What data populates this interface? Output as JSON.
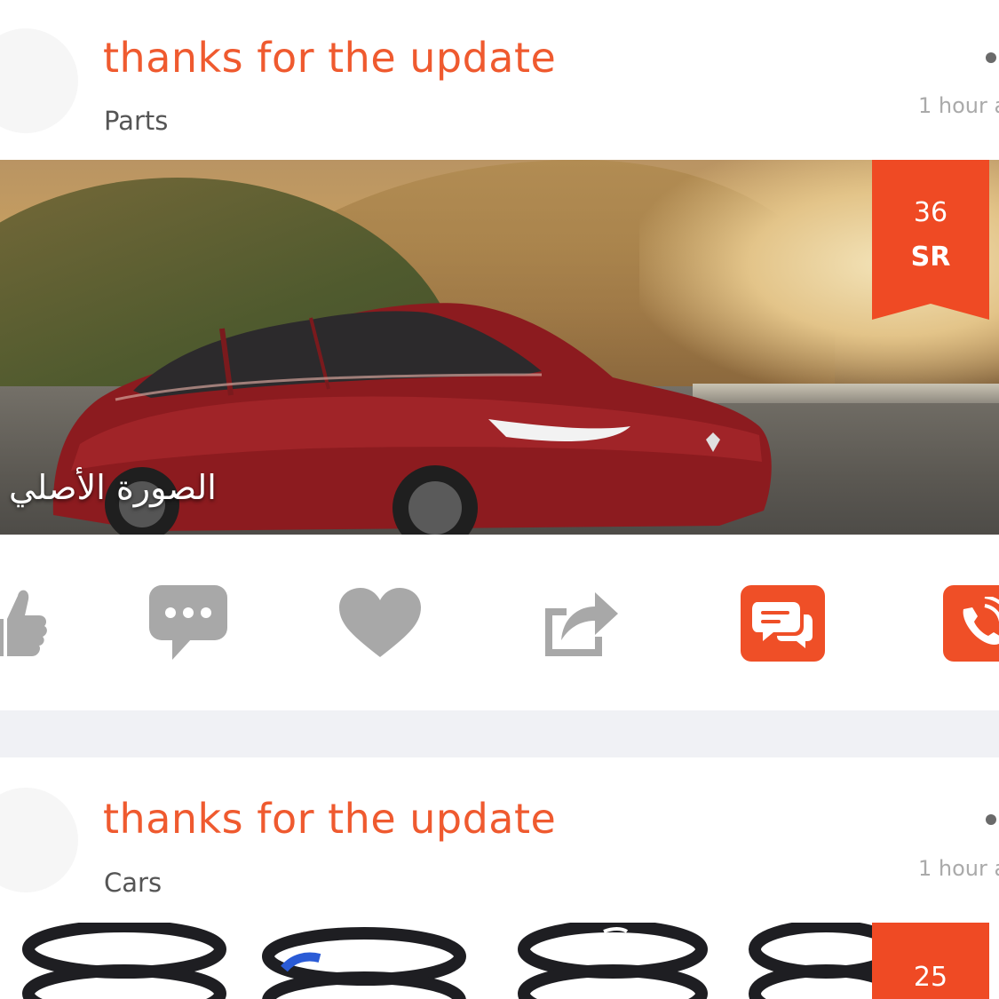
{
  "colors": {
    "accent": "#ef5a2f",
    "badge": "#ef4a24",
    "icon_gray": "#a8a8a8",
    "separator": "#f0f1f5"
  },
  "posts": [
    {
      "title": "thanks for the update",
      "category": "Parts",
      "time": "1 hour a",
      "image_caption": "الصورة الأصلي",
      "price": {
        "amount": "36",
        "currency": "SR"
      },
      "actions": [
        {
          "icon": "thumbs-up-icon"
        },
        {
          "icon": "comment-icon"
        },
        {
          "icon": "heart-icon"
        },
        {
          "icon": "share-icon"
        },
        {
          "icon": "chat-icon"
        },
        {
          "icon": "phone-call-icon"
        }
      ]
    },
    {
      "title": "thanks for the update",
      "category": "Cars",
      "time": "1 hour a",
      "price": {
        "amount": "25"
      }
    }
  ]
}
